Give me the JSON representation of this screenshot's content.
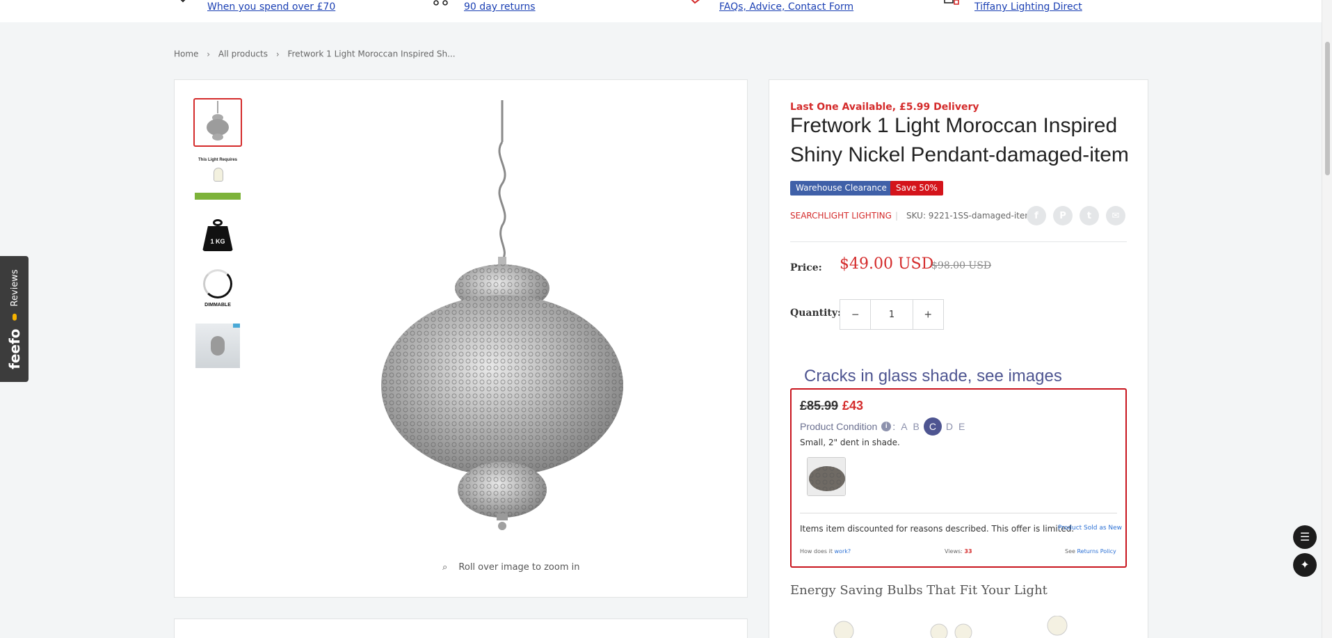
{
  "benefits": [
    {
      "icon": "delivery-icon",
      "text": "When you spend over £70"
    },
    {
      "icon": "returns-icon",
      "text": "90 day returns"
    },
    {
      "icon": "help-icon",
      "text": "FAQs, Advice, Contact Form"
    },
    {
      "icon": "contact-icon",
      "text": "Tiffany Lighting Direct"
    }
  ],
  "breadcrumb": [
    "Home",
    "All products",
    "Fretwork 1 Light Moroccan Inspired Sh..."
  ],
  "gallery": {
    "thumbnails": [
      {
        "name": "thumb-pendant",
        "label": ""
      },
      {
        "name": "thumb-bulb-requirement",
        "label": "This Light Requires"
      },
      {
        "name": "thumb-weight",
        "label": "1 KG"
      },
      {
        "name": "thumb-dimmable",
        "label": "DIMMABLE"
      },
      {
        "name": "thumb-room",
        "label": ""
      }
    ],
    "zoom_hint": "Roll over image to zoom in"
  },
  "product": {
    "availability": "Last One Available, £5.99 Delivery",
    "title": "Fretwork 1 Light Moroccan Inspired Shiny Nickel Pendant-damaged-item",
    "badges": {
      "clearance": "Warehouse Clearance",
      "save": "Save 50%"
    },
    "vendor": "SEARCHLIGHT LIGHTING",
    "sku": "SKU: 9221-1SS-damaged-item",
    "share": [
      {
        "icon": "facebook-icon",
        "glyph": "f"
      },
      {
        "icon": "pinterest-icon",
        "glyph": "P"
      },
      {
        "icon": "twitter-icon",
        "glyph": "t"
      },
      {
        "icon": "email-icon",
        "glyph": "✉"
      }
    ],
    "price_label": "Price:",
    "price": "$49.00 USD",
    "compare_price": "$98.00 USD",
    "quantity_label": "Quantity:",
    "quantity": "1"
  },
  "damage_offer": {
    "heading": "Cracks in glass shade, see images",
    "old_price": "£85.99",
    "new_price": "£43",
    "condition_label": "Product Condition",
    "grades": [
      "A",
      "B",
      "C",
      "D",
      "E"
    ],
    "selected_grade": "C",
    "note": "Small, 2\" dent in shade.",
    "offer_text": "Items item discounted for reasons described. This offer is limited.",
    "sold_as_new": "Product Sold as New",
    "how_prefix": "How does it ",
    "how_link": "work?",
    "views_label": "Views: ",
    "views_count": "33",
    "see_prefix": "See ",
    "see_link": "Returns Policy"
  },
  "energy_heading": "Energy Saving Bulbs That Fit Your Light",
  "feefo": {
    "logo": "feefo",
    "label": "Reviews"
  },
  "colors": {
    "accent_red": "#d42b2b",
    "badge_blue": "#3f60a8",
    "condition_purple": "#4e5591",
    "link_blue": "#1a3fb3"
  }
}
